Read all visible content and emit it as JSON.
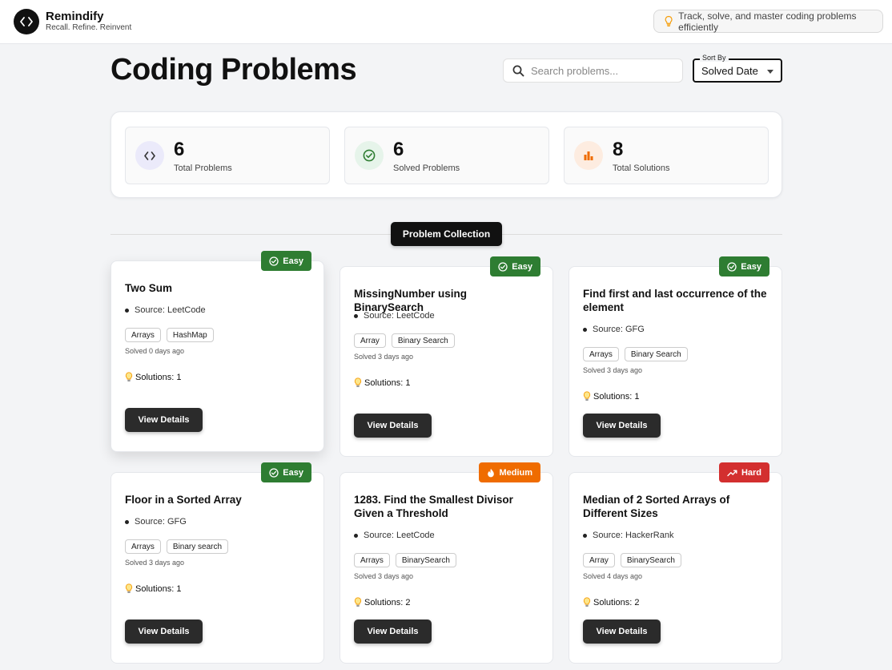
{
  "app": {
    "name": "Remindify",
    "tagline": "Recall. Refine. Reinvent",
    "tip": "Track, solve, and master coding problems efficiently"
  },
  "page": {
    "title": "Coding Problems"
  },
  "search": {
    "placeholder": "Search problems..."
  },
  "sort": {
    "label": "Sort By",
    "value": "Solved Date"
  },
  "stats": [
    {
      "value": "6",
      "label": "Total Problems",
      "icon": "code-icon",
      "color": "#5c6bc0"
    },
    {
      "value": "6",
      "label": "Solved Problems",
      "icon": "check-circle-icon",
      "color": "#2e7d32"
    },
    {
      "value": "8",
      "label": "Total Solutions",
      "icon": "bar-chart-icon",
      "color": "#ef6c00"
    }
  ],
  "collection": {
    "label": "Problem Collection"
  },
  "problems": [
    {
      "title": "Two Sum",
      "difficulty": "Easy",
      "source": "Source: LeetCode",
      "tags": [
        "Arrays",
        "HashMap"
      ],
      "solved": "Solved 0 days ago",
      "solutions": "Solutions: 1",
      "button": "View Details"
    },
    {
      "title": "MissingNumber using BinarySearch",
      "difficulty": "Easy",
      "source": "Source: LeetCode",
      "tags": [
        "Array",
        "Binary Search"
      ],
      "solved": "Solved 3 days ago",
      "solutions": "Solutions: 1",
      "button": "View Details"
    },
    {
      "title": "Find first and last occurrence of the element",
      "difficulty": "Easy",
      "source": "Source: GFG",
      "tags": [
        "Arrays",
        "Binary Search"
      ],
      "solved": "Solved 3 days ago",
      "solutions": "Solutions: 1",
      "button": "View Details"
    },
    {
      "title": "Floor in a Sorted Array",
      "difficulty": "Easy",
      "source": "Source: GFG",
      "tags": [
        "Arrays",
        "Binary search"
      ],
      "solved": "Solved 3 days ago",
      "solutions": "Solutions: 1",
      "button": "View Details"
    },
    {
      "title": "1283. Find the Smallest Divisor Given a Threshold",
      "difficulty": "Medium",
      "source": "Source: LeetCode",
      "tags": [
        "Arrays",
        "BinarySearch"
      ],
      "solved": "Solved 3 days ago",
      "solutions": "Solutions: 2",
      "button": "View Details"
    },
    {
      "title": "Median of 2 Sorted Arrays of Different Sizes",
      "difficulty": "Hard",
      "source": "Source: HackerRank",
      "tags": [
        "Array",
        "BinarySearch"
      ],
      "solved": "Solved 4 days ago",
      "solutions": "Solutions: 2",
      "button": "View Details"
    }
  ]
}
